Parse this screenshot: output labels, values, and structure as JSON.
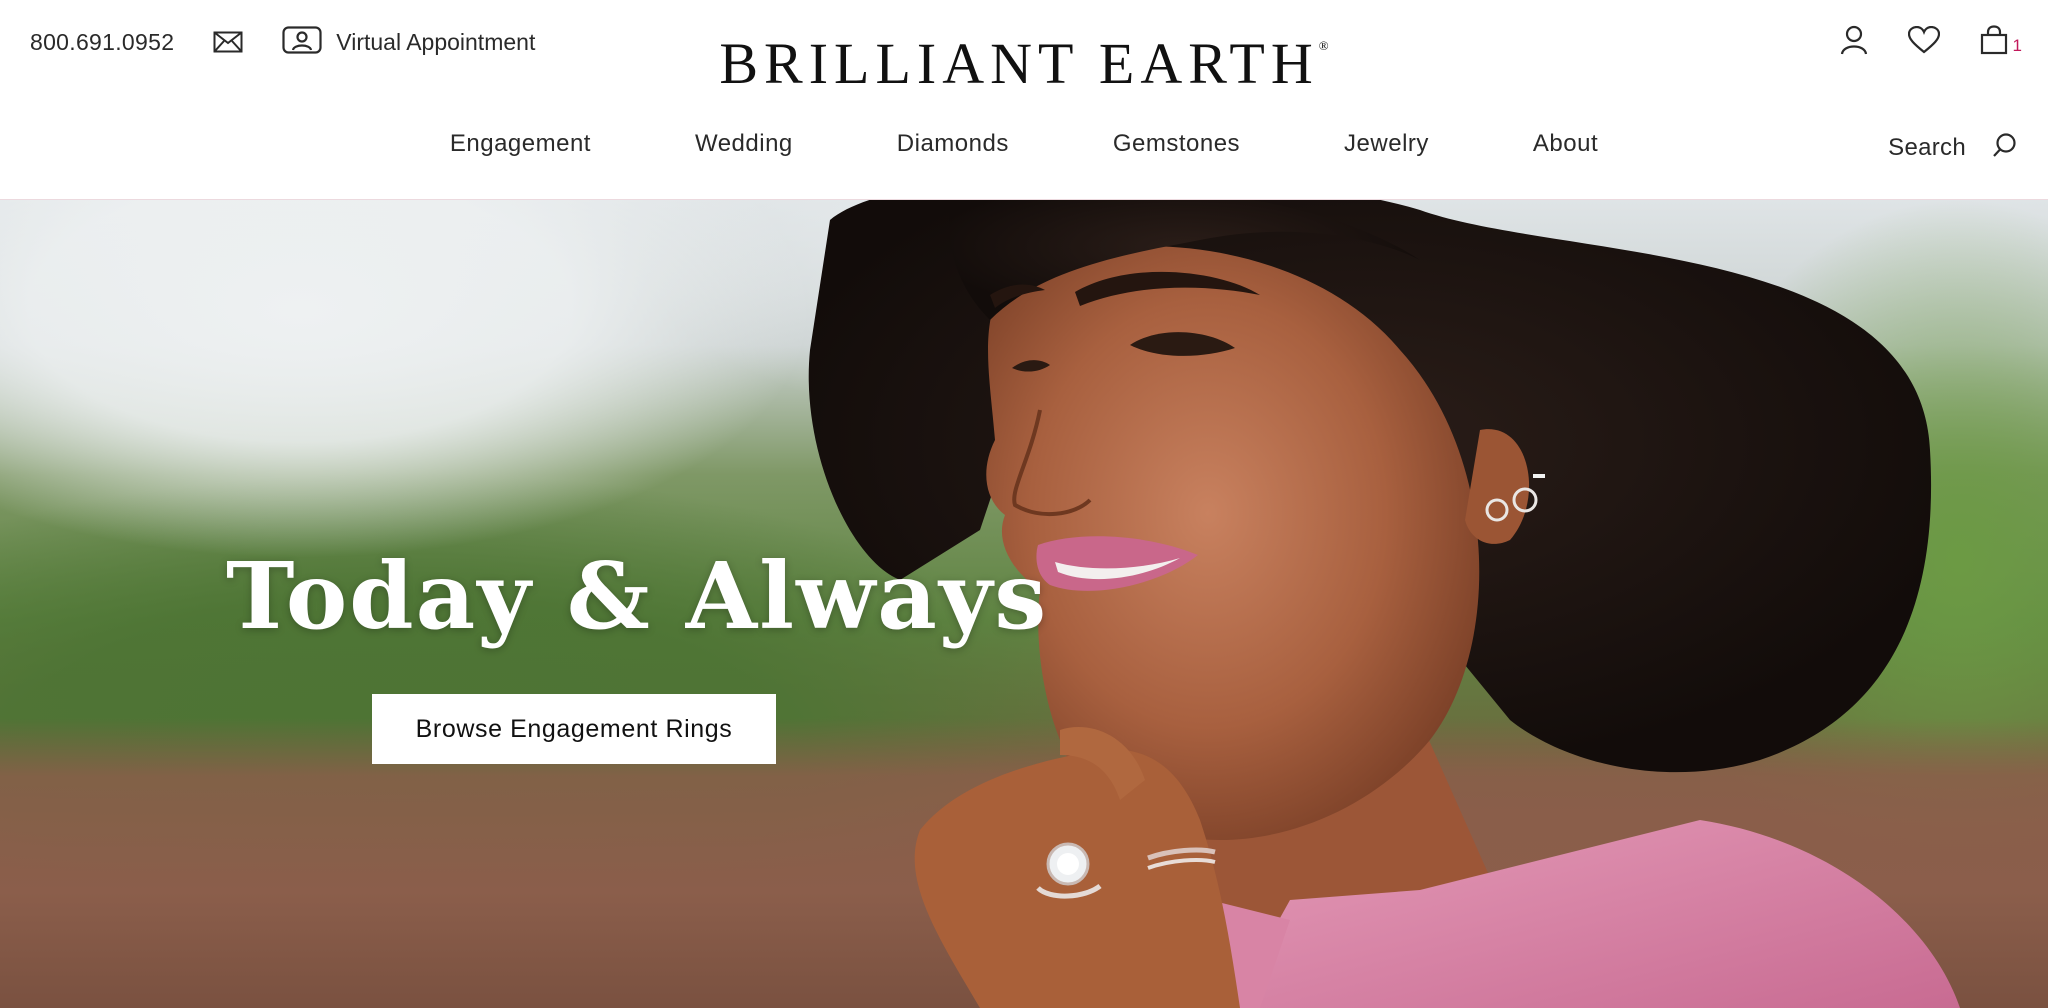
{
  "utility": {
    "phone": "800.691.0952",
    "mail_icon": "mail-icon",
    "virtual_icon": "video-person-icon",
    "virtual_label": "Virtual Appointment"
  },
  "logo": {
    "text": "BRILLIANT EARTH",
    "reg": "®"
  },
  "account": {
    "account_icon": "user-icon",
    "wishlist_icon": "heart-icon",
    "cart_icon": "shopping-bag-icon",
    "cart_count": "1"
  },
  "nav": {
    "items": [
      {
        "label": "Engagement"
      },
      {
        "label": "Wedding"
      },
      {
        "label": "Diamonds"
      },
      {
        "label": "Gemstones"
      },
      {
        "label": "Jewelry"
      },
      {
        "label": "About"
      }
    ],
    "search_label": "Search",
    "search_icon": "search-icon"
  },
  "hero": {
    "headline": "Today & Always",
    "cta_label": "Browse Engagement Rings"
  },
  "colors": {
    "cart_badge": "#c2185b",
    "cta_bg": "#ffffff",
    "headline": "#ffffff"
  }
}
